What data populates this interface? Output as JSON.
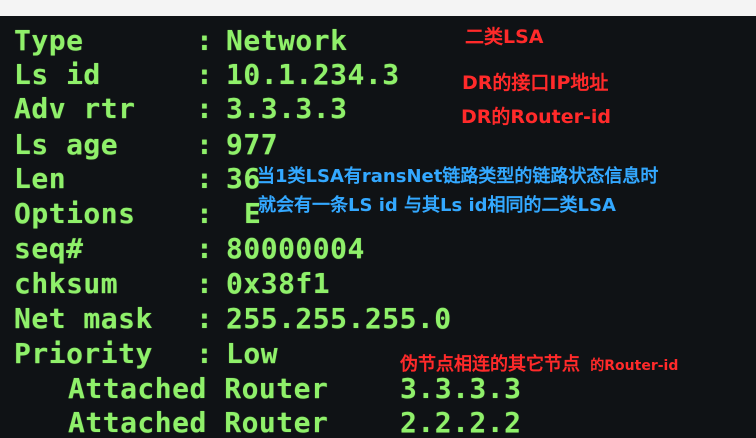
{
  "fields": [
    {
      "key": "Type",
      "value": "Network"
    },
    {
      "key": "Ls id",
      "value": "10.1.234.3"
    },
    {
      "key": "Adv rtr",
      "value": "3.3.3.3"
    },
    {
      "key": "Ls age",
      "value": "977"
    },
    {
      "key": "Len",
      "value": "36"
    },
    {
      "key": "Options",
      "value": "E"
    },
    {
      "key": "seq#",
      "value": "80000004"
    },
    {
      "key": "chksum",
      "value": "0x38f1"
    },
    {
      "key": "Net mask",
      "value": "255.255.255.0"
    },
    {
      "key": "Priority",
      "value": "Low"
    }
  ],
  "separator": ":",
  "attached": [
    {
      "label": "Attached Router",
      "value": "3.3.3.3"
    },
    {
      "label": "Attached Router",
      "value": "2.2.2.2"
    }
  ],
  "annotations": {
    "type_note": "二类LSA",
    "lsid_note": "DR的接口IP地址",
    "advrtr_note": "DR的Router-id",
    "blue_line1": "当1类LSA有ransNet链路类型的链路状态信息时",
    "blue_line2": "就会有一条LS id 与其Ls id相同的二类LSA",
    "attached_note_main": "伪节点相连的其它节点",
    "attached_note_suffix": "的Router-id"
  },
  "colors": {
    "terminal_text": "#8ff06a",
    "annotation_red": "#ff2a2a",
    "annotation_blue": "#33a8ff",
    "terminal_bg": "#0f1215"
  }
}
